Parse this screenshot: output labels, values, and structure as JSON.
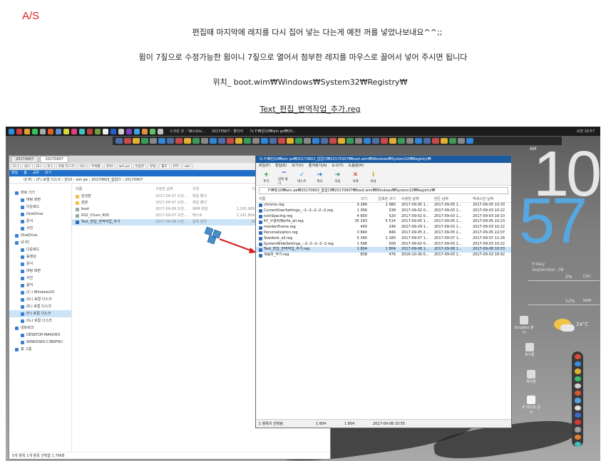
{
  "post": {
    "tag": "A/S",
    "line1": "편집때 마지막에 레지를 다시 집어 넣는 다는게 예전 꺼를 넣었나보내요^^;;",
    "line2": "윔이 7짚으로 수정가능한 윔이니 7짚으로 열어서 첨부한 레지를 마우스로 끌어서 넣어 주시면 됩니다",
    "line3": "위치_ boot.wim₩Windows₩System32₩Registry₩",
    "line4": "Text_편집_번역작업_추가.reg"
  },
  "taskbar": {
    "time": "오전 10:57",
    "items": [
      "스크린 샷 - 'Win10x...",
      "20170907 - 폴더어",
      "7z F:₩윈10₩win pe₩20..."
    ]
  },
  "explorer": {
    "tabs": [
      "20170907",
      "20170907"
    ],
    "toolbar": [
      "(C:)",
      "(D:)",
      "(E:)",
      "(F:)",
      "로컬 디스크",
      "(G:)",
      "트윅툴",
      "윈10",
      "win pe",
      "유용한",
      "유틸",
      "툴도",
      "ETC",
      "win"
    ],
    "ribbon": [
      "파일",
      "홈",
      "공유",
      "보기"
    ],
    "address": "내 PC  ›  (F:) 로컬 디스크  ›  윈10  ›  win pe  ›  20170803_합압다  ›  20170907",
    "nav": [
      {
        "label": "바로 가기",
        "sub": false,
        "sel": false
      },
      {
        "label": "바탕 화면",
        "sub": true,
        "sel": false
      },
      {
        "label": "다운로드",
        "sub": true,
        "sel": false
      },
      {
        "label": "OneDrive",
        "sub": true,
        "sel": false
      },
      {
        "label": "문서",
        "sub": true,
        "sel": false
      },
      {
        "label": "사진",
        "sub": true,
        "sel": false
      },
      {
        "label": "OneDrive",
        "sub": false,
        "sel": false
      },
      {
        "label": "내 PC",
        "sub": false,
        "sel": false
      },
      {
        "label": "다운로드",
        "sub": true,
        "sel": false
      },
      {
        "label": "동영상",
        "sub": true,
        "sel": false
      },
      {
        "label": "문서",
        "sub": true,
        "sel": false
      },
      {
        "label": "바탕 화면",
        "sub": true,
        "sel": false
      },
      {
        "label": "사진",
        "sub": true,
        "sel": false
      },
      {
        "label": "음악",
        "sub": true,
        "sel": false
      },
      {
        "label": "(C:) Windows10",
        "sub": true,
        "sel": false
      },
      {
        "label": "(D:) 로컬 디스크",
        "sub": true,
        "sel": false
      },
      {
        "label": "(E:) 로컬 디스크",
        "sub": true,
        "sel": false
      },
      {
        "label": "(F:) 로컬 디스크",
        "sub": true,
        "sel": true
      },
      {
        "label": "(G:) 로컬 디스크",
        "sub": true,
        "sel": false
      },
      {
        "label": "네트워크",
        "sub": false,
        "sel": false
      },
      {
        "label": "DESKTOP-MA4OHO",
        "sub": true,
        "sel": false
      },
      {
        "label": "WINDOWS-C3B0F8U",
        "sub": true,
        "sel": false
      },
      {
        "label": "홈 그룹",
        "sub": false,
        "sel": false
      }
    ],
    "columns": [
      "이름",
      "수정한 날짜",
      "유형",
      "크기"
    ],
    "files": [
      {
        "name": "완성본",
        "date": "2017-09-07 오전...",
        "type": "파일 폴더",
        "size": "",
        "kind": "folder"
      },
      {
        "name": "원본",
        "date": "2017-09-07 오전...",
        "type": "파일 폴더",
        "size": "",
        "kind": "folder"
      },
      {
        "name": "boot",
        "date": "2017-09-08 오전...",
        "type": "WIM 파일",
        "size": "1,205,989...",
        "kind": "file"
      },
      {
        "name": "RS2_Chum_RS5",
        "date": "2017-09-07 오전...",
        "type": "텍스트",
        "size": "1,241,864...",
        "kind": "file"
      },
      {
        "name": "Text_편집_번역작업_추가",
        "date": "2017-09-08 오전...",
        "type": "등록 항목",
        "size": "2KB",
        "kind": "reg"
      }
    ],
    "status": "5개 항목    1개 항목 선택함 1.76KB"
  },
  "sevenzip": {
    "title": "7z F:₩윈10₩win pe₩20170803_합압다₩20170907₩boot.wim₩Windows₩System32₩Registry₩",
    "menu": [
      "파일(F)",
      "편집(E)",
      "보기(V)",
      "즐겨찾기(A)",
      "도구(T)",
      "도움말(H)"
    ],
    "tools": [
      {
        "label": "추가",
        "glyph": "+",
        "color": "#2b9b2b"
      },
      {
        "label": "압축 풀기",
        "glyph": "−",
        "color": "#2a54b8"
      },
      {
        "label": "테스트",
        "glyph": "✓",
        "color": "#1c9bc9"
      },
      {
        "label": "복사",
        "glyph": "➔",
        "color": "#1f6fb8"
      },
      {
        "label": "이동",
        "glyph": "➔",
        "color": "#1f8f5f"
      },
      {
        "label": "삭제",
        "glyph": "✕",
        "color": "#d42020"
      },
      {
        "label": "속성",
        "glyph": "i",
        "color": "#c9a018"
      }
    ],
    "path": "F:₩윈10₩win pe₩20170803_합압다₩20170907₩boot.wim₩Windows₩System32₩Registry₩",
    "columns": [
      "이름",
      "크기",
      "압축된 크기",
      "수정한 날짜",
      "만든 날짜",
      "액세스한 날짜"
    ],
    "rows": [
      {
        "name": "chrome.reg",
        "size": "9 284",
        "packed": "2 980",
        "mod": "2017-09-05 1...",
        "created": "2017-09-05 1...",
        "acc": "2017-09-05 10:33"
      },
      {
        "name": "CurrentUserSettings_--2--2--2--2--2.reg",
        "size": "1 056",
        "packed": "538",
        "mod": "2017-09-02 0...",
        "created": "2017-09-03 1...",
        "acc": "2017-09-03 10:22"
      },
      {
        "name": "iconSpacing.reg",
        "size": "4 650",
        "packed": "520",
        "mod": "2017-09-02 0...",
        "created": "2017-09-03 1...",
        "acc": "2017-09-03 18:10"
      },
      {
        "name": "KY_우클릭메뉴Pa_all.reg",
        "size": "35 293",
        "packed": "5 514",
        "mod": "2017-09-05 1...",
        "created": "2017-09-05 1...",
        "acc": "2017-09-05 10:23"
      },
      {
        "name": "mordenFrame.reg",
        "size": "400",
        "packed": "246",
        "mod": "2017-09-29 1...",
        "created": "2017-09-03 1...",
        "acc": "2017-09-03 10:22"
      },
      {
        "name": "Personalization.reg",
        "size": "3 840",
        "packed": "846",
        "mod": "2017-09-05 2...",
        "created": "2017-09-05 2...",
        "acc": "2017-09-05 22:07"
      },
      {
        "name": "Stardock_all.reg",
        "size": "5 340",
        "packed": "1 180",
        "mod": "2017-09-07 1...",
        "created": "2017-09-07 1...",
        "acc": "2017-09-07 11:24"
      },
      {
        "name": "SystemWideSettings_--2--2--2--2--2.reg",
        "size": "1 596",
        "packed": "500",
        "mod": "2017-09-02 0...",
        "created": "2017-09-03 1...",
        "acc": "2017-09-03 10:22"
      },
      {
        "name": "Text_편집_번역작업_추가.reg",
        "size": "1 804",
        "packed": "1 804",
        "mod": "2017-09-08 1...",
        "created": "2017-09-08 1...",
        "acc": "2017-09-08 10:53"
      },
      {
        "name": "새롤라_추가.reg",
        "size": "838",
        "packed": "476",
        "mod": "2016-10-30 0...",
        "created": "2017-09-03 1...",
        "acc": "2017-09-03 16:42"
      }
    ],
    "status": [
      "1 항목이 선택됨",
      "1 804",
      "1 804",
      "2017-09-08 10:55"
    ]
  },
  "widgets": {
    "ampm": "AM",
    "hour": "10",
    "minute": "57",
    "day": "Friday",
    "date": "September ,08",
    "cpu_label": "CPU",
    "cpu_val": "2%",
    "ram_label": "RAM",
    "ram_val": "12%",
    "weather": "24°C",
    "desk_icons": [
      "Dropbox 폴더",
      "휴지통",
      "제어판",
      "새 텍스트 문서"
    ]
  }
}
